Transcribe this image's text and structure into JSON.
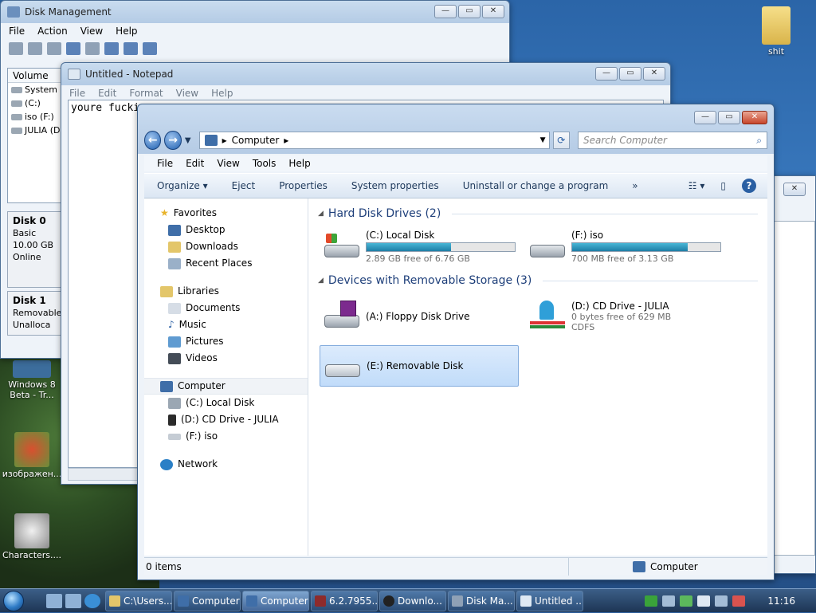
{
  "desktop": {
    "icons": [
      {
        "label": "shit"
      },
      {
        "label": "Windows 8 Beta - Tr..."
      },
      {
        "label": "изображен..."
      },
      {
        "label": "Characters...."
      }
    ]
  },
  "disk_mgmt": {
    "title": "Disk Management",
    "menu": [
      "File",
      "Action",
      "View",
      "Help"
    ],
    "list_header": "Volume",
    "volumes": [
      "System R",
      "(C:)",
      "iso (F:)",
      "JULIA (D:"
    ],
    "disk0": {
      "name": "Disk 0",
      "type": "Basic",
      "size": "10.00 GB",
      "status": "Online"
    },
    "disk1": {
      "name": "Disk 1",
      "type": "Removable",
      "status": "Unalloca"
    }
  },
  "notepad": {
    "title": "Untitled - Notepad",
    "menu": [
      "File",
      "Edit",
      "Format",
      "View",
      "Help"
    ],
    "text": "youre fucki"
  },
  "explorer": {
    "address": "Computer",
    "search_placeholder": "Search Computer",
    "menu": [
      "File",
      "Edit",
      "View",
      "Tools",
      "Help"
    ],
    "commands": [
      "Organize ▾",
      "Eject",
      "Properties",
      "System properties",
      "Uninstall or change a program",
      "»"
    ],
    "nav": {
      "favorites": "Favorites",
      "desktop": "Desktop",
      "downloads": "Downloads",
      "recent": "Recent Places",
      "libraries": "Libraries",
      "documents": "Documents",
      "music": "Music",
      "pictures": "Pictures",
      "videos": "Videos",
      "computer": "Computer",
      "c": "(C:) Local Disk",
      "d": "(D:) CD Drive - JULIA",
      "f": "(F:) iso",
      "network": "Network"
    },
    "groups": {
      "hdd": "Hard Disk Drives (2)",
      "removable": "Devices with Removable Storage (3)"
    },
    "drives": {
      "c": {
        "name": "(C:) Local Disk",
        "free": "2.89 GB free of 6.76 GB",
        "used_fraction": 0.57
      },
      "f": {
        "name": "(F:) iso",
        "free": "700 MB free of 3.13 GB",
        "used_fraction": 0.78
      },
      "a": {
        "name": "(A:) Floppy Disk Drive"
      },
      "d": {
        "name": "(D:) CD Drive - JULIA",
        "free": "0 bytes free of 629 MB",
        "fs": "CDFS"
      },
      "e": {
        "name": "(E:) Removable Disk"
      }
    },
    "status_items": "0 items",
    "status_location": "Computer"
  },
  "taskbar": {
    "tasks": [
      "C:\\Users...",
      "Computer",
      "Computer",
      "6.2.7955....",
      "Downlo...",
      "Disk Ma...",
      "Untitled ..."
    ],
    "clock": "11:16"
  }
}
